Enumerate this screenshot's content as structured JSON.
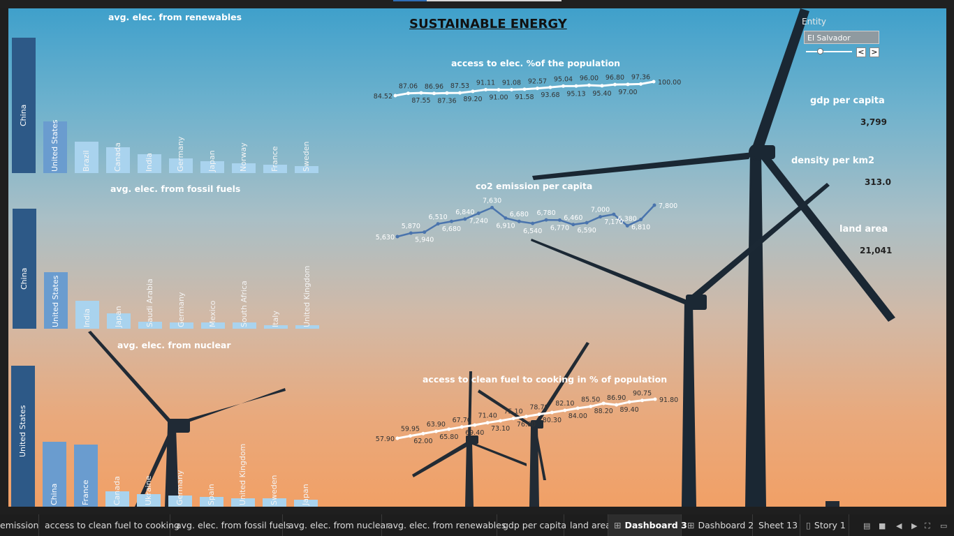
{
  "dashboard": {
    "title": "SUSTAINABLE ENERGY",
    "entity_filter": {
      "label": "Entity",
      "value": "El Salvador",
      "prev_symbol": "<",
      "next_symbol": ">"
    },
    "kpis": [
      {
        "title": "gdp per capita",
        "value": "3,799"
      },
      {
        "title": "density per km2",
        "value": "313.0"
      },
      {
        "title": "land area",
        "value": "21,041"
      }
    ]
  },
  "tabs": [
    {
      "label": "emission",
      "icon": ""
    },
    {
      "label": "access to clean fuel to cooking",
      "icon": ""
    },
    {
      "label": "avg. elec. from fossil fuels",
      "icon": ""
    },
    {
      "label": "avg. elec. from nuclear",
      "icon": ""
    },
    {
      "label": "avg. elec. from renewables",
      "icon": ""
    },
    {
      "label": "gdp per capita",
      "icon": ""
    },
    {
      "label": "land area",
      "icon": ""
    },
    {
      "label": "Dashboard 3",
      "icon": "grid-icon",
      "active": true
    },
    {
      "label": "Dashboard 2",
      "icon": "grid-icon"
    },
    {
      "label": "Sheet 13",
      "icon": ""
    },
    {
      "label": "Story 1",
      "icon": "story-icon"
    }
  ],
  "colors": {
    "dark_bar": "#2d5987",
    "mid_bar": "#6a9ccf",
    "light_bar": "#a9d3ee",
    "line_white": "#ffffff",
    "line_blue": "#4a74ad"
  },
  "chart_data": [
    {
      "type": "bar",
      "title": "avg. elec. from renewables",
      "categories": [
        "China",
        "United States",
        "Brazil",
        "Canada",
        "India",
        "Germany",
        "Japan",
        "Norway",
        "France",
        "Sweden"
      ],
      "values": [
        100,
        38,
        23,
        19,
        14,
        11,
        9,
        7,
        6,
        5
      ]
    },
    {
      "type": "bar",
      "title": "avg. elec. from fossil fuels",
      "categories": [
        "China",
        "United States",
        "India",
        "Japan",
        "Saudi Arabia",
        "Germany",
        "Mexico",
        "South Africa",
        "Italy",
        "United Kingdom"
      ],
      "values": [
        100,
        47,
        23,
        13,
        6,
        5,
        5,
        5,
        3,
        3
      ]
    },
    {
      "type": "bar",
      "title": "avg. elec. from nuclear",
      "categories": [
        "United States",
        "China",
        "France",
        "Canada",
        "Ukraine",
        "Germany",
        "Spain",
        "United Kingdom",
        "Sweden",
        "Japan"
      ],
      "values": [
        100,
        46,
        44,
        11,
        9,
        8,
        7,
        6,
        6,
        5
      ]
    },
    {
      "type": "line",
      "title": "access to elec. %of the population",
      "values": [
        84.52,
        87.06,
        87.55,
        86.96,
        87.36,
        87.53,
        89.2,
        91.11,
        91.0,
        91.08,
        91.58,
        92.57,
        93.68,
        95.04,
        95.13,
        96.0,
        95.4,
        96.8,
        97.0,
        97.36,
        100.0
      ],
      "labels": [
        "84.52",
        "87.06",
        "87.55",
        "86.96",
        "87.36",
        "87.53",
        "89.20",
        "91.11",
        "91.00",
        "91.08",
        "91.58",
        "92.57",
        "93.68",
        "95.04",
        "95.13",
        "96.00",
        "95.40",
        "96.80",
        "97.00",
        "97.36",
        "100.00"
      ]
    },
    {
      "type": "line",
      "title": "co2 emission per capita",
      "values": [
        5630,
        5870,
        5940,
        6510,
        6680,
        6840,
        7240,
        7630,
        6910,
        6680,
        6540,
        6780,
        6770,
        6460,
        6590,
        7000,
        7170,
        6380,
        6810,
        7800
      ],
      "labels": [
        "5,630",
        "5,870",
        "5,940",
        "6,510",
        "6,680",
        "6,840",
        "7,240",
        "7,630",
        "6,910",
        "6,680",
        "6,540",
        "6,780",
        "6,770",
        "6,460",
        "6,590",
        "7,000",
        "7,170",
        "6,380",
        "6,810",
        "7,800"
      ]
    },
    {
      "type": "line",
      "title": "access to clean fuel to cooking in % of population",
      "values": [
        57.9,
        59.95,
        62.0,
        63.9,
        65.8,
        67.7,
        69.4,
        71.4,
        73.1,
        75.1,
        76.8,
        78.7,
        80.3,
        82.1,
        84.0,
        85.5,
        88.2,
        86.9,
        89.4,
        90.75,
        91.8
      ],
      "labels": [
        "57.90",
        "59.95",
        "62.00",
        "63.90",
        "65.80",
        "67.70",
        "69.40",
        "71.40",
        "73.10",
        "75.10",
        "76.80",
        "78.70",
        "80.30",
        "82.10",
        "84.00",
        "85.50",
        "88.20",
        "86.90",
        "89.40",
        "90.75",
        "91.80"
      ]
    }
  ]
}
